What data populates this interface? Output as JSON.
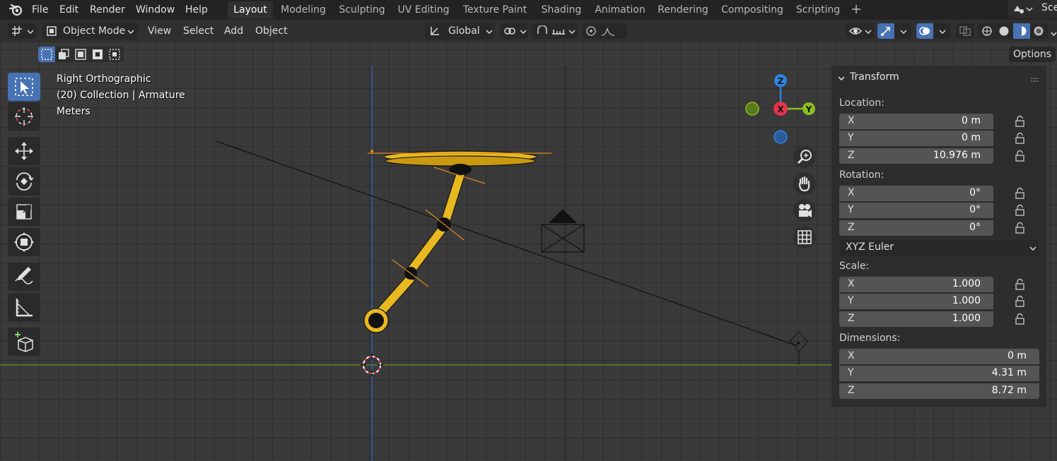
{
  "menu": {
    "items": [
      "File",
      "Edit",
      "Render",
      "Window",
      "Help"
    ]
  },
  "workspaces": {
    "tabs": [
      "Layout",
      "Modeling",
      "Sculpting",
      "UV Editing",
      "Texture Paint",
      "Shading",
      "Animation",
      "Rendering",
      "Compositing",
      "Scripting"
    ],
    "active": "Layout",
    "scene_label": "Sce"
  },
  "header": {
    "mode": "Object Mode",
    "view": "View",
    "select": "Select",
    "add": "Add",
    "object": "Object",
    "orientation": "Global",
    "options": "Options"
  },
  "viewport": {
    "view_name": "Right Orthographic",
    "collection_info": "(20) Collection | Armature",
    "units": "Meters",
    "gizmo": {
      "x": "X",
      "y": "Y",
      "z": "Z"
    }
  },
  "npanel": {
    "title": "Transform",
    "location_label": "Location:",
    "location": [
      {
        "axis": "X",
        "value": "0 m"
      },
      {
        "axis": "Y",
        "value": "0 m"
      },
      {
        "axis": "Z",
        "value": "10.976 m"
      }
    ],
    "rotation_label": "Rotation:",
    "rotation": [
      {
        "axis": "X",
        "value": "0°"
      },
      {
        "axis": "Y",
        "value": "0°"
      },
      {
        "axis": "Z",
        "value": "0°"
      }
    ],
    "rotation_mode": "XYZ Euler",
    "scale_label": "Scale:",
    "scale": [
      {
        "axis": "X",
        "value": "1.000"
      },
      {
        "axis": "Y",
        "value": "1.000"
      },
      {
        "axis": "Z",
        "value": "1.000"
      }
    ],
    "dimensions_label": "Dimensions:",
    "dimensions": [
      {
        "axis": "X",
        "value": "0 m"
      },
      {
        "axis": "Y",
        "value": "4.31 m"
      },
      {
        "axis": "Z",
        "value": "8.72 m"
      }
    ]
  },
  "colors": {
    "accent": "#4772b3",
    "armature": "#e8b820",
    "x_axis": "#e2344c",
    "y_axis": "#8bbf22",
    "z_axis": "#2f84e3"
  }
}
